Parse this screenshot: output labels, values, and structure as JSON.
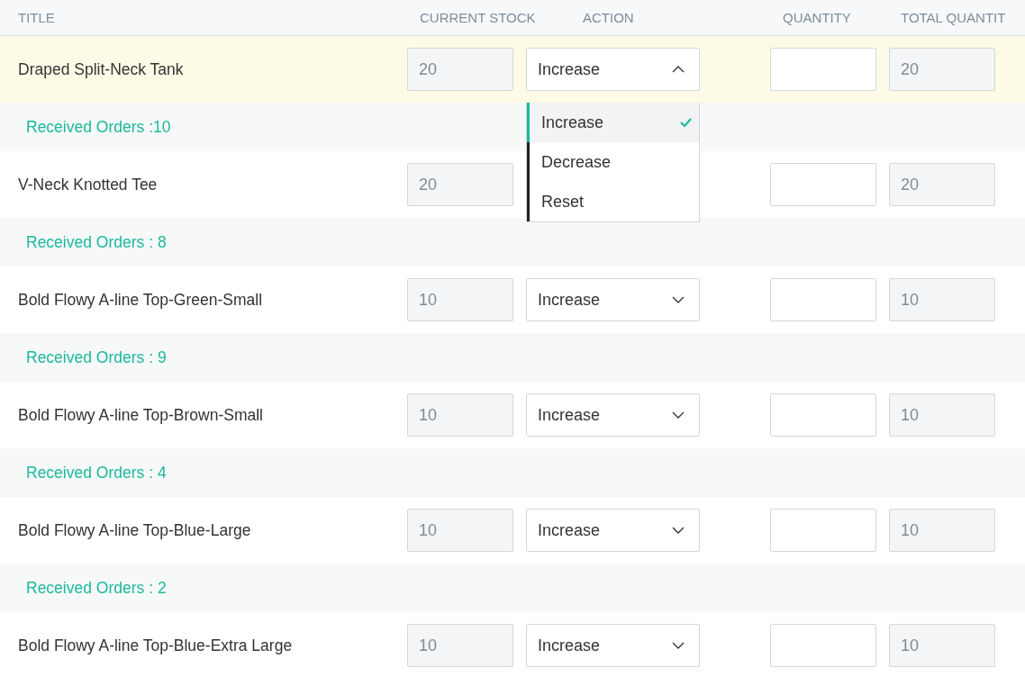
{
  "columns": [
    "TITLE",
    "CURRENT STOCK",
    "ACTION",
    "QUANTITY",
    "TOTAL QUANTIT"
  ],
  "rows": [
    {
      "title": "Draped Split-Neck Tank",
      "current_stock": "20",
      "action": "Increase",
      "total_quantity": "20",
      "highlighted": true,
      "expanded": true,
      "options": [
        {
          "label": "Increase",
          "selected": true
        },
        {
          "label": "Decrease",
          "selected": false
        },
        {
          "label": "Reset",
          "selected": false
        }
      ],
      "received_orders": "Received Orders :10"
    },
    {
      "title": "V-Neck Knotted Tee",
      "current_stock": "20",
      "total_quantity": "20",
      "highlighted": false,
      "received_orders": "Received Orders : 8"
    },
    {
      "title": "Bold Flowy A-line Top-Green-Small",
      "current_stock": "10",
      "action": "Increase",
      "total_quantity": "10",
      "highlighted": false,
      "expanded": false,
      "received_orders": "Received Orders : 9"
    },
    {
      "title": "Bold Flowy A-line Top-Brown-Small",
      "current_stock": "10",
      "action": "Increase",
      "total_quantity": "10",
      "highlighted": false,
      "expanded": false,
      "received_orders": "Received Orders : 4"
    },
    {
      "title": "Bold Flowy A-line Top-Blue-Large",
      "current_stock": "10",
      "action": "Increase",
      "total_quantity": "10",
      "highlighted": false,
      "expanded": false,
      "received_orders": "Received Orders : 2"
    },
    {
      "title": "Bold Flowy A-line Top-Blue-Extra Large",
      "current_stock": "10",
      "action": "Increase",
      "total_quantity": "10",
      "highlighted": false,
      "expanded": false
    }
  ]
}
